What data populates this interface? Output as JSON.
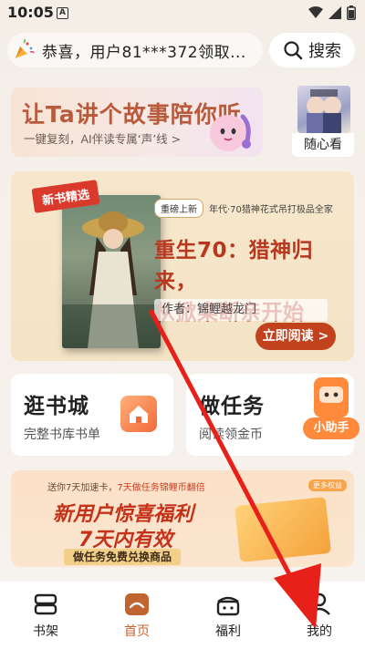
{
  "status_bar": {
    "time": "10:05",
    "badge": "A"
  },
  "header": {
    "notice_text": "恭喜，用户81***372领取...",
    "search_label": "搜索"
  },
  "banner_story": {
    "title": "让Ta讲个故事陪你听",
    "subtitle": "一键复刻，AI伴读专属‘声’线",
    "chevron": ">"
  },
  "side_book": {
    "label": "随心看"
  },
  "feature": {
    "ribbon": "新书精选",
    "tag": "重磅上新",
    "tag_text": "年代·70猎神花式吊打极品全家",
    "title_line1": "重生70：猎神归来，",
    "title_line2": "从掀桌断亲开始",
    "author": "作者：锦鲤越龙门",
    "read_button": "立即阅读 >"
  },
  "cards": {
    "bookstore_title": "逛书城",
    "bookstore_sub": "完整书库书单",
    "tasks_title": "做任务",
    "tasks_sub": "阅读领金币",
    "helper_label": "小助手"
  },
  "promo": {
    "line1_a": "送你7天加速卡，",
    "line1_b": "7天做任务锦鲤币翻倍",
    "chip": "更多权益",
    "big1": "新用户惊喜福利",
    "big2": "7天内有效",
    "bar": "做任务免费兑换商品"
  },
  "nav": {
    "items": [
      {
        "label": "书架",
        "icon": "bookshelf-icon"
      },
      {
        "label": "首页",
        "icon": "home-icon"
      },
      {
        "label": "福利",
        "icon": "gift-icon"
      },
      {
        "label": "我的",
        "icon": "profile-icon"
      }
    ],
    "active_index": 1
  },
  "colors": {
    "accent": "#c2421e",
    "arrow": "#e8201a",
    "nav_active": "#c2642f"
  }
}
